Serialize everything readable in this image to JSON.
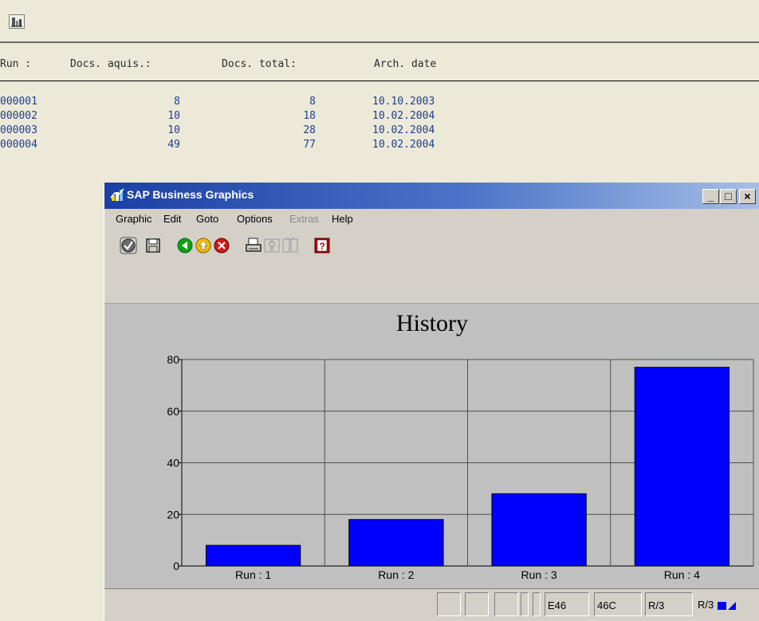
{
  "list": {
    "headers": {
      "run": "Run :",
      "docs_aquis": "Docs. aquis.:",
      "docs_total": "Docs. total:",
      "arch_date": "Arch. date"
    },
    "rows": [
      {
        "run": "000001",
        "docs_aquis": "8",
        "docs_total": "8",
        "arch_date": "10.10.2003"
      },
      {
        "run": "000002",
        "docs_aquis": "10",
        "docs_total": "18",
        "arch_date": "10.02.2004"
      },
      {
        "run": "000003",
        "docs_aquis": "10",
        "docs_total": "28",
        "arch_date": "10.02.2004"
      },
      {
        "run": "000004",
        "docs_aquis": "49",
        "docs_total": "77",
        "arch_date": "10.02.2004"
      }
    ]
  },
  "dialog": {
    "title": "SAP Business Graphics",
    "window_buttons": {
      "minimize": "_",
      "maximize": "□",
      "close": "×"
    },
    "menu": [
      {
        "label": "Graphic",
        "enabled": true
      },
      {
        "label": "Edit",
        "enabled": true
      },
      {
        "label": "Goto",
        "enabled": true
      },
      {
        "label": "Options",
        "enabled": true
      },
      {
        "label": "Extras",
        "enabled": false
      },
      {
        "label": "Help",
        "enabled": true
      }
    ],
    "toolbar_icons": [
      "enter-icon",
      "save-icon",
      "back-icon",
      "exit-icon",
      "cancel-icon",
      "print-icon",
      "find-icon",
      "find-next-icon",
      "help-icon"
    ]
  },
  "chart_data": {
    "type": "bar",
    "title": "History",
    "categories": [
      "Run : 1",
      "Run : 2",
      "Run : 3",
      "Run : 4"
    ],
    "values": [
      8,
      18,
      28,
      77
    ],
    "ylim": [
      0,
      80
    ],
    "yticks": [
      0,
      20,
      40,
      60,
      80
    ],
    "grid": true,
    "legend": "none",
    "bar_color": "#0000ff"
  },
  "status": {
    "system": "E46",
    "client": "46C",
    "mode": "R/3",
    "right_label": "R/3"
  },
  "colors": {
    "list_text": "#1f3f8f",
    "titlebar": "#1c3fa3",
    "bar": "#0000ff",
    "chart_bg": "#c0c0c0"
  }
}
